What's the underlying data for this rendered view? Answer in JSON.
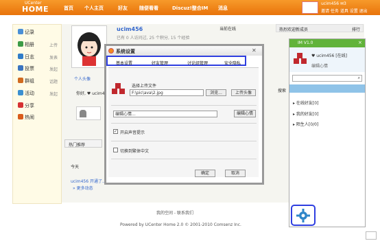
{
  "topnav": {
    "logo_small": "UCenter",
    "logo_big": "HOME",
    "items": [
      "首页",
      "个人主页",
      "好友",
      "随便看看",
      "Discuz!整合IM",
      "消息"
    ],
    "user_line1": "ucim456 ✉3",
    "user_line2": "邀请 任务 道具 设置 退出"
  },
  "sidebar": {
    "items": [
      {
        "label": "记录",
        "color": "#4a8fd6",
        "extra": ""
      },
      {
        "label": "相册",
        "color": "#3c9b46",
        "extra": "上传"
      },
      {
        "label": "日志",
        "color": "#2f7cc8",
        "extra": "发表"
      },
      {
        "label": "投票",
        "color": "#3a74c0",
        "extra": "发起"
      },
      {
        "label": "群组",
        "color": "#d06a1f",
        "extra": "话题"
      },
      {
        "label": "活动",
        "color": "#3b8fd0",
        "extra": "发起"
      },
      {
        "label": "分享",
        "color": "#d63232",
        "extra": ""
      },
      {
        "label": "热闹",
        "color": "#d95b1a",
        "extra": ""
      }
    ]
  },
  "profile": {
    "username": "ucim456",
    "stats": "已有 0 人访问过, 25 个积分, 15 个经验",
    "online": "当前在线",
    "avatar_caption": "个人头像",
    "hello": "你好, ♥ ucim456",
    "hot": "热门推荐",
    "today": "今天",
    "feed1": "ucim456 开通了...",
    "feed2": "» 更多动态"
  },
  "right": {
    "newfriends": "热烈欢迎新成员",
    "newfriends_extra": "排行",
    "search": "搜索"
  },
  "dialog": {
    "title": "系统设置",
    "tabs": [
      "基本设置",
      "好友管理",
      "讨论组管理",
      "安全隐私"
    ],
    "upload_label": "选择上传文件",
    "upload_path": "F:\\pic\\ava\\2.jpg",
    "browse": "浏览...",
    "upload_btn": "上传头像",
    "mood_placeholder": "编辑心情...",
    "mood_btn": "编辑心情",
    "check1": "开启声音提示",
    "check1_checked": true,
    "check2": "切换到繁体中文",
    "check2_checked": false,
    "ok": "确定",
    "cancel": "取消"
  },
  "im": {
    "version": "IM V1.0",
    "user": "♥ ucim456 [在线]",
    "mood": "编辑心情",
    "groups": [
      "在线好友[0]",
      "我的好友[0]",
      "陌生人[0/0]"
    ]
  },
  "footer": {
    "line1": "我的空间 - 联系我们",
    "line2": "Powered by UCenter Home 2.0 © 2001-2010 Comsenz Inc."
  }
}
